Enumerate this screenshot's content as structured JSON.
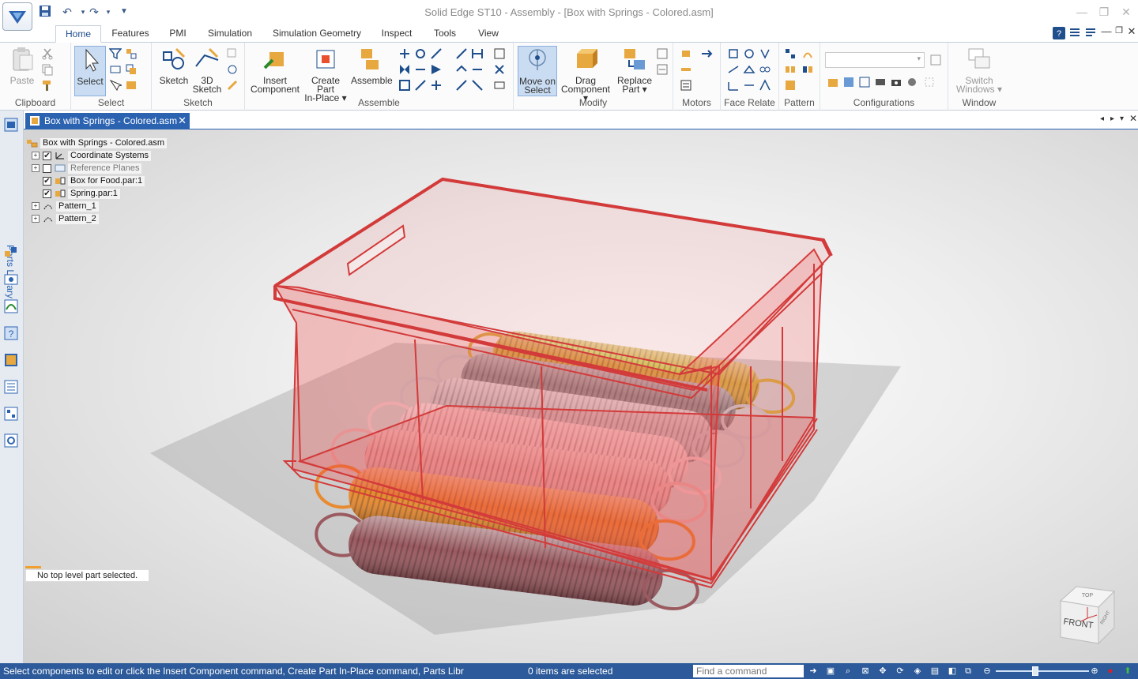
{
  "window": {
    "title": "Solid Edge ST10 - Assembly - [Box with Springs - Colored.asm]"
  },
  "quick_access": [
    "save-icon",
    "undo-icon",
    "redo-icon",
    "customize-icon"
  ],
  "ribbon_tabs": [
    {
      "label": "Home",
      "active": true
    },
    {
      "label": "Features"
    },
    {
      "label": "PMI"
    },
    {
      "label": "Simulation"
    },
    {
      "label": "Simulation Geometry"
    },
    {
      "label": "Inspect"
    },
    {
      "label": "Tools"
    },
    {
      "label": "View"
    }
  ],
  "ribbon": {
    "clipboard": {
      "label": "Clipboard",
      "paste": "Paste"
    },
    "select": {
      "label": "Select",
      "select": "Select"
    },
    "sketch": {
      "label": "Sketch",
      "sketch": "Sketch",
      "sketch3d_1": "3D",
      "sketch3d_2": "Sketch"
    },
    "assemble": {
      "label": "Assemble",
      "insert_1": "Insert",
      "insert_2": "Component",
      "create_1": "Create Part",
      "create_2": "In-Place",
      "assemble": "Assemble"
    },
    "modify": {
      "label": "Modify",
      "move_1": "Move on",
      "move_2": "Select",
      "drag_1": "Drag",
      "drag_2": "Component",
      "replace_1": "Replace",
      "replace_2": "Part"
    },
    "motors": {
      "label": "Motors"
    },
    "face_relate": {
      "label": "Face Relate"
    },
    "pattern": {
      "label": "Pattern"
    },
    "configurations": {
      "label": "Configurations"
    },
    "window": {
      "label": "Window",
      "switch_1": "Switch",
      "switch_2": "Windows"
    }
  },
  "document_tab": {
    "label": "Box with Springs - Colored.asm"
  },
  "left_dock": {
    "parts_library": "Parts Library"
  },
  "tree": {
    "root": "Box with Springs - Colored.asm",
    "items": [
      {
        "label": "Coordinate Systems",
        "checked": true,
        "expandable": true
      },
      {
        "label": "Reference Planes",
        "checked": false,
        "expandable": true
      },
      {
        "label": "Box for Food.par:1",
        "checked": true,
        "expandable": false
      },
      {
        "label": "Spring.par:1",
        "checked": true,
        "expandable": false
      },
      {
        "label": "Pattern_1",
        "expandable": true
      },
      {
        "label": "Pattern_2",
        "expandable": true
      }
    ]
  },
  "selection_note": "No top level part selected.",
  "view_cube": {
    "front": "FRONT",
    "top": "TOP",
    "right": "RIGHT"
  },
  "springs": [
    {
      "color": "#d7b54a"
    },
    {
      "color": "#8f9396"
    },
    {
      "color": "#c9ccd0"
    },
    {
      "color": "#eed3d6"
    },
    {
      "color": "#e7b6b6"
    },
    {
      "color": "#e88a30"
    },
    {
      "color": "#9a5a60"
    }
  ],
  "box_color": "#ee5a5a",
  "status_bar": {
    "message": "Select components to edit or click the Insert Component command, Create Part In-Place command, Parts Libr",
    "count": "0 items are selected",
    "find_placeholder": "Find a command"
  }
}
